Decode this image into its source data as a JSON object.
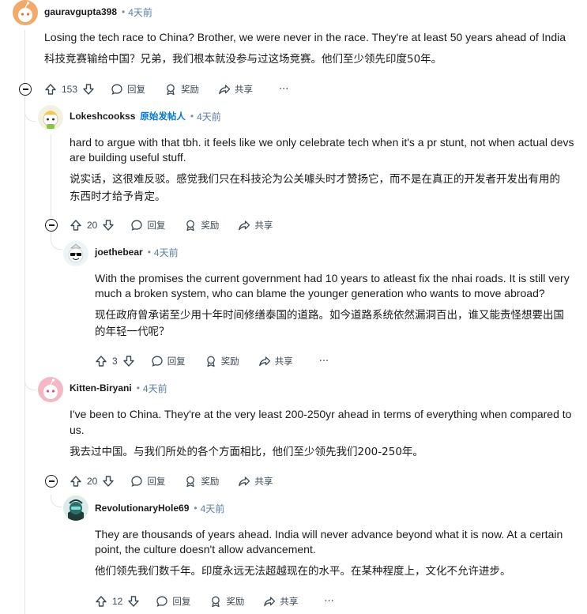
{
  "comments": [
    {
      "username": "gauravgupta398",
      "time": "4天前",
      "text_en": "Losing the tech race to China? Brother, we were never in the race. They're at least 50 years ahead of India",
      "text_zh": "科技竞赛输给中国？兄弟，我们根本就没参与过这场竞赛。他们至少领先印度50年。",
      "votes": "153"
    },
    {
      "username": "Lokeshcookss",
      "op_label": "原始发帖人",
      "time": "4天前",
      "text_en_1": "hard to argue with that tbh. it feels like we only celebrate tech when it's a pr stunt, not when actual devs",
      "text_en_2": "are building useful stuff.",
      "text_zh_1": "说实话，这很难反驳。感觉我们只在科技沦为公关噱头时才赞扬它，而不是在真正的开发者开发出有用的",
      "text_zh_2": "东西时才给予肯定。",
      "votes": "20"
    },
    {
      "username": "joethebear",
      "time": "4天前",
      "text_en_1": "With the promises the current government had 10 years to atleast fix the nhai roads. It is still very",
      "text_en_2": "much a broken system, who can blame the younger generation who wants to move abroad?",
      "text_zh_1": "现任政府曾承诺至少用十年时间修缮泰国的道路。如今道路系统依然漏洞百出，谁又能责怪想要出国",
      "text_zh_2": "的年轻一代呢？",
      "votes": "3"
    },
    {
      "username": "Kitten-Biryani",
      "time": "4天前",
      "text_en_1": "I've been to China. They're at the very least 200-250yr ahead in terms of everything when compared to",
      "text_en_2": "us.",
      "text_zh": "我去过中国。与我们所处的各个方面相比，他们至少领先我们200-250年。",
      "votes": "20"
    },
    {
      "username": "RevolutionaryHole69",
      "time": "4天前",
      "text_en_1": "They are thousands of years ahead. India will never advance beyond what it is now. At a certain",
      "text_en_2": "point, the culture doesn't allow advancement.",
      "text_zh": "他们领先我们数千年。印度永远无法超越现在的水平。在某种程度上，文化不允许进步。",
      "votes": "12"
    }
  ],
  "actions": {
    "reply": "回复",
    "award": "奖励",
    "share": "共享",
    "more": "···"
  },
  "icons": {
    "upvote": "upvote-arrow-icon",
    "downvote": "downvote-arrow-icon",
    "reply": "speech-bubble-icon",
    "award": "award-ribbon-icon",
    "share": "share-arrow-icon",
    "collapse": "collapse-minus-icon"
  },
  "colors": {
    "op_label": "#0079d3",
    "time": "#5a7da8",
    "thread_line": "#e0e4e6"
  }
}
